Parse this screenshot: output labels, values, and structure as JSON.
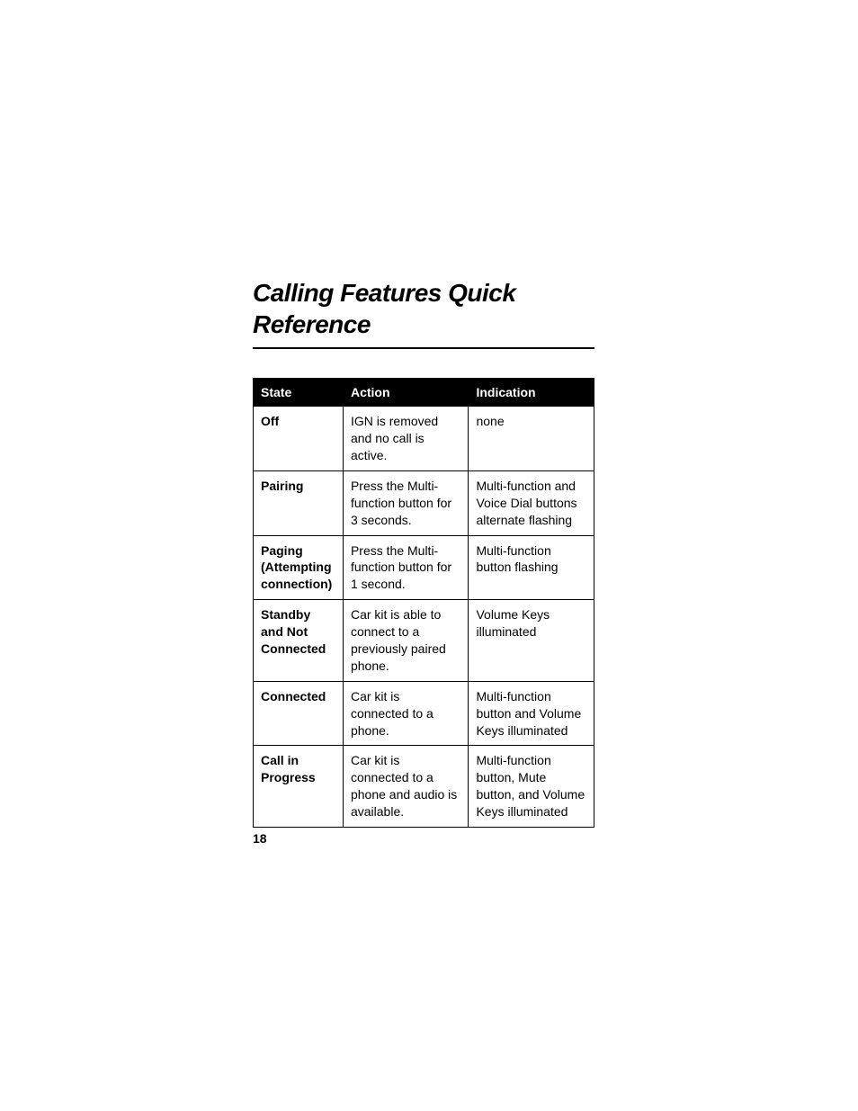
{
  "title": "Calling Features Quick Reference",
  "page_number": "18",
  "table": {
    "headers": {
      "state": "State",
      "action": "Action",
      "indication": "Indication"
    },
    "rows": [
      {
        "state": "Off",
        "action": "IGN is removed and no call is active.",
        "indication": "none"
      },
      {
        "state": "Pairing",
        "action": "Press the Multi-function button for 3 seconds.",
        "indication": "Multi-function and Voice Dial buttons alternate flashing"
      },
      {
        "state": "Paging (Attempting connection)",
        "action": "Press the Multi-function button for 1 second.",
        "indication": "Multi-function button flashing"
      },
      {
        "state": "Standby and Not Connected",
        "action": "Car kit is able to connect to a previously paired phone.",
        "indication": "Volume Keys illuminated"
      },
      {
        "state": "Connected",
        "action": "Car kit is connected to a phone.",
        "indication": "Multi-function button and Volume Keys illuminated"
      },
      {
        "state": "Call in Progress",
        "action": "Car kit is connected to a phone and audio is available.",
        "indication": "Multi-function button, Mute button, and Volume Keys illuminated"
      }
    ]
  }
}
